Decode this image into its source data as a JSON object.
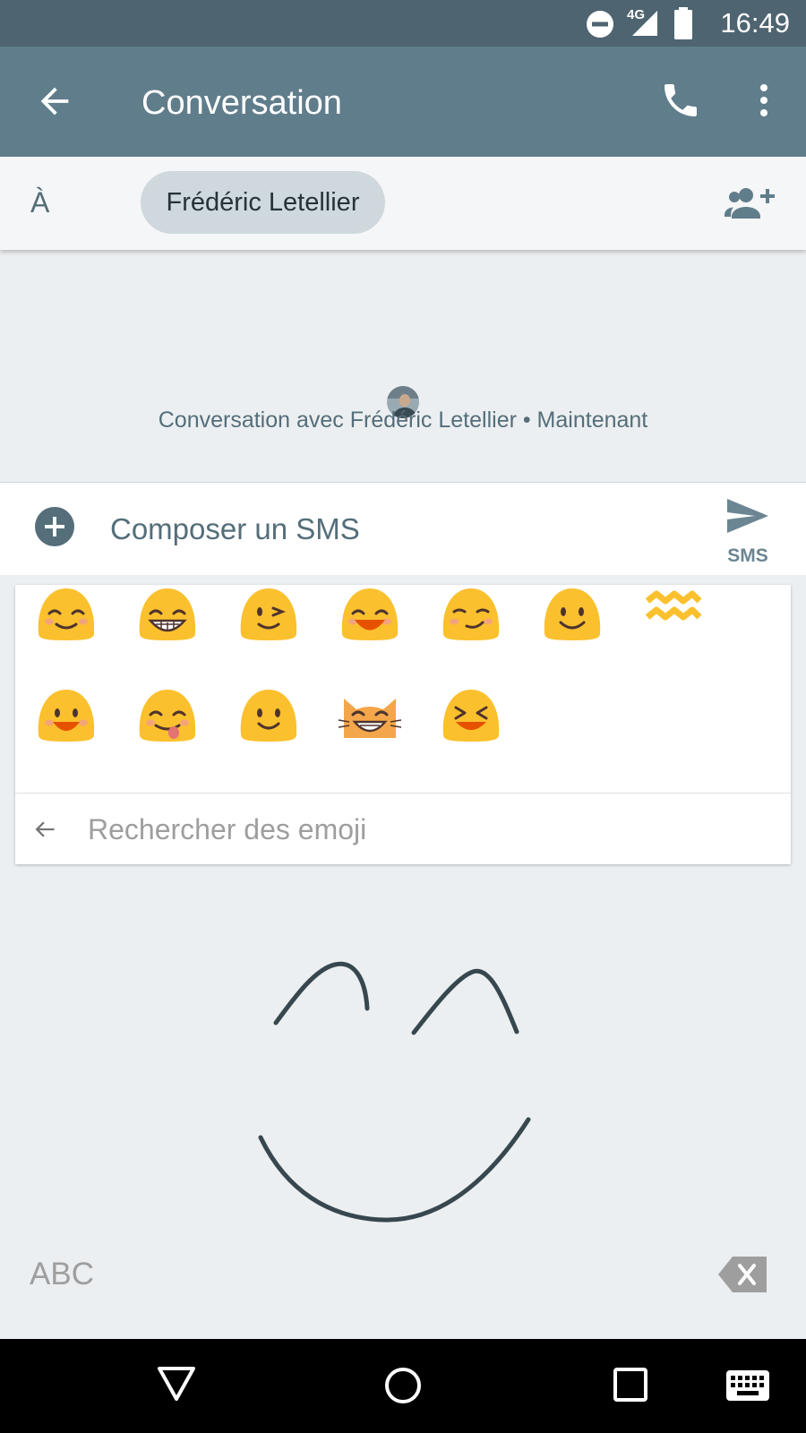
{
  "status_bar": {
    "network": "4G",
    "time": "16:49"
  },
  "app_bar": {
    "title": "Conversation",
    "icons": [
      "back-arrow-icon",
      "phone-icon",
      "more-vert-icon"
    ]
  },
  "recipients": {
    "to_label": "À",
    "chip_name": "Frédéric Letellier",
    "add_icon": "add-person-icon"
  },
  "conversation": {
    "info_text": "Conversation avec Frédéric Letellier • Maintenant"
  },
  "compose": {
    "placeholder": "Composer un SMS",
    "send_label": "SMS"
  },
  "emoji_panel": {
    "emojis": [
      {
        "name": "smiling-eyes-emoji"
      },
      {
        "name": "grinning-teeth-emoji"
      },
      {
        "name": "winking-emoji"
      },
      {
        "name": "laughing-emoji"
      },
      {
        "name": "smirking-emoji"
      },
      {
        "name": "slight-smile-emoji"
      },
      {
        "name": "wavy-lines-emoji"
      },
      {
        "name": "open-mouth-smile-emoji"
      },
      {
        "name": "tongue-out-emoji"
      },
      {
        "name": "simple-smile-emoji"
      },
      {
        "name": "grinning-cat-emoji"
      },
      {
        "name": "squinting-laugh-emoji"
      }
    ],
    "search_placeholder": "Rechercher des emoji"
  },
  "handwriting": {
    "mode_label": "ABC"
  },
  "colors": {
    "status_bar": "#4e6471",
    "app_bar": "#607d8b",
    "background": "#eceff1",
    "chip": "#cfd8dc",
    "emoji_yellow": "#fbc02d",
    "ink": "#37474f"
  }
}
